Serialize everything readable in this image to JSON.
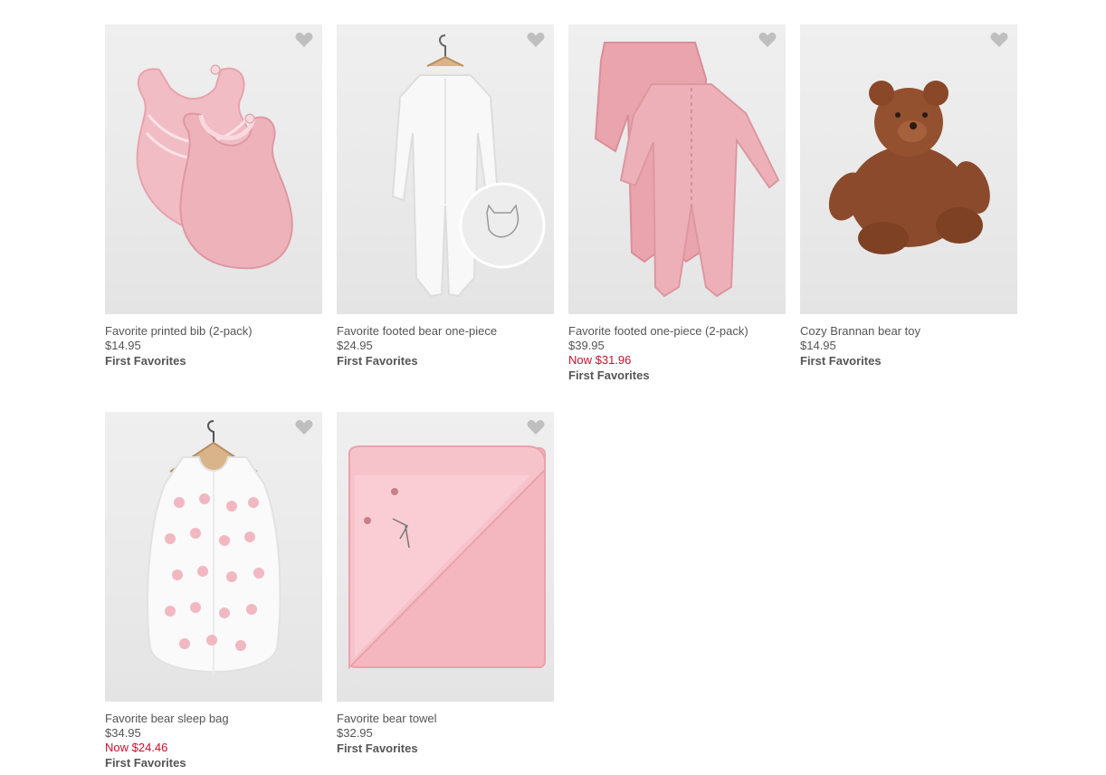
{
  "colors": {
    "text": "#555555",
    "sale": "#c8102e",
    "image_bg": "#ececec",
    "heart": "#bfbfbf"
  },
  "products": [
    {
      "name": "Favorite printed bib (2-pack)",
      "price": "$14.95",
      "sale_price": "",
      "collection": "First Favorites",
      "image": "pink-bibs",
      "favorite_icon": "heart-icon"
    },
    {
      "name": "Favorite footed bear one-piece",
      "price": "$24.95",
      "sale_price": "",
      "collection": "First Favorites",
      "image": "white-bear-one-piece",
      "favorite_icon": "heart-icon"
    },
    {
      "name": "Favorite footed one-piece (2-pack)",
      "price": "$39.95",
      "sale_price": "Now $31.96",
      "collection": "First Favorites",
      "image": "pink-one-pieces",
      "favorite_icon": "heart-icon"
    },
    {
      "name": "Cozy Brannan bear toy",
      "price": "$14.95",
      "sale_price": "",
      "collection": "First Favorites",
      "image": "brown-teddy-bear",
      "favorite_icon": "heart-icon"
    },
    {
      "name": "Favorite bear sleep bag",
      "price": "$34.95",
      "sale_price": "Now $24.46",
      "collection": "First Favorites",
      "image": "bear-sleep-bag",
      "favorite_icon": "heart-icon"
    },
    {
      "name": "Favorite bear towel",
      "price": "$32.95",
      "sale_price": "",
      "collection": "First Favorites",
      "image": "pink-hooded-towel",
      "favorite_icon": "heart-icon"
    }
  ]
}
